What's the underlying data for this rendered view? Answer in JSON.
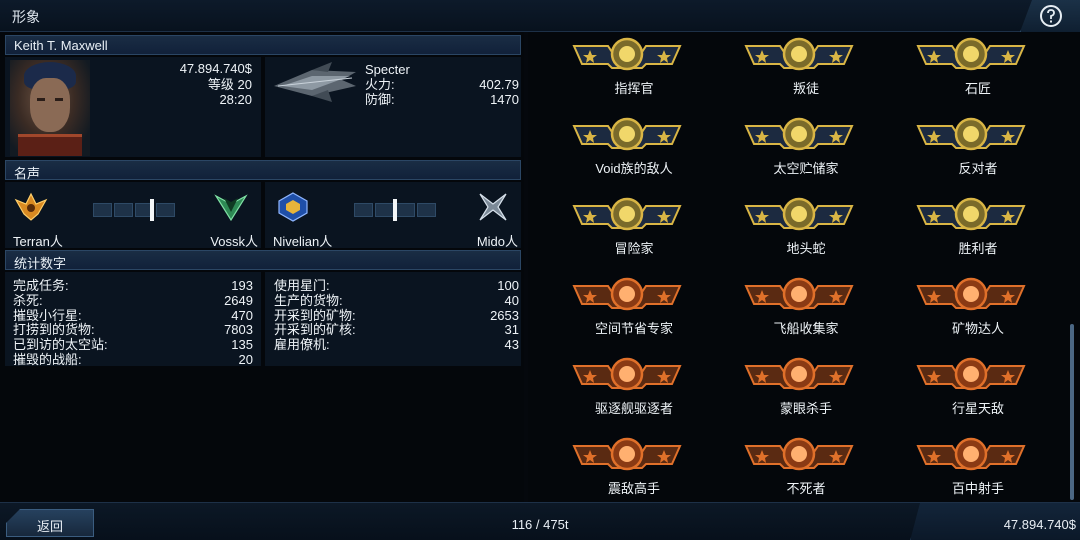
{
  "topbar": {
    "title": "形象"
  },
  "profile": {
    "header": "Keith T. Maxwell",
    "credits": "47.894.740$",
    "level": "等级 20",
    "playtime": "28:20",
    "ship_name": "Specter",
    "firepower_label": "火力:",
    "firepower_value": "402.79",
    "defense_label": "防御:",
    "defense_value": "1470"
  },
  "reputation": {
    "header": "名声",
    "pairs": [
      {
        "left": "Terran人",
        "right": "Vossk人",
        "marker_fraction": 0.72
      },
      {
        "left": "Nivelian人",
        "right": "Mido人",
        "marker_fraction": 0.5
      }
    ]
  },
  "stats": {
    "header": "统计数字",
    "left": [
      {
        "label": "完成任务:",
        "value": "193"
      },
      {
        "label": "杀死:",
        "value": "2649"
      },
      {
        "label": "摧毁小行星:",
        "value": "470"
      },
      {
        "label": "打捞到的货物:",
        "value": "7803"
      },
      {
        "label": "已到访的太空站:",
        "value": "135"
      },
      {
        "label": "摧毁的战船:",
        "value": "20"
      }
    ],
    "right": [
      {
        "label": "使用星门:",
        "value": "100"
      },
      {
        "label": "生产的货物:",
        "value": "40"
      },
      {
        "label": "开采到的矿物:",
        "value": "2653"
      },
      {
        "label": "开采到的矿核:",
        "value": "31"
      },
      {
        "label": "雇用僚机:",
        "value": "43"
      }
    ]
  },
  "achievements": [
    {
      "label": "指挥官",
      "tier": "gold",
      "icon": "commander-icon"
    },
    {
      "label": "叛徒",
      "tier": "gold",
      "icon": "traitor-icon"
    },
    {
      "label": "石匠",
      "tier": "gold",
      "icon": "mason-icon"
    },
    {
      "label": "Void族的敌人",
      "tier": "gold",
      "icon": "peace-hand-icon"
    },
    {
      "label": "太空贮储家",
      "tier": "gold",
      "icon": "cube-icon"
    },
    {
      "label": "反对者",
      "tier": "gold",
      "icon": "cross-icon"
    },
    {
      "label": "冒险家",
      "tier": "gold",
      "icon": "fist-icon"
    },
    {
      "label": "地头蛇",
      "tier": "gold",
      "icon": "starburst-icon"
    },
    {
      "label": "胜利者",
      "tier": "gold",
      "icon": "trophy-icon"
    },
    {
      "label": "空间节省专家",
      "tier": "bronze",
      "icon": "crate-icon"
    },
    {
      "label": "飞船收集家",
      "tier": "bronze",
      "icon": "p-icon"
    },
    {
      "label": "矿物达人",
      "tier": "bronze",
      "icon": "mineral-icon"
    },
    {
      "label": "驱逐舰驱逐者",
      "tier": "bronze",
      "icon": "flame-icon"
    },
    {
      "label": "蒙眼杀手",
      "tier": "bronze",
      "icon": "claw-icon"
    },
    {
      "label": "行星天敌",
      "tier": "bronze",
      "icon": "planet-icon"
    },
    {
      "label": "震敌高手",
      "tier": "bronze",
      "icon": "shock-icon"
    },
    {
      "label": "不死者",
      "tier": "bronze",
      "icon": "undead-icon"
    },
    {
      "label": "百中射手",
      "tier": "bronze",
      "icon": "target-icon"
    }
  ],
  "bottombar": {
    "back_label": "返回",
    "cargo": "116 / 475t",
    "credits": "47.894.740$"
  },
  "colors": {
    "gold": "#d9b545",
    "bronze": "#e0702a",
    "panel": "#0a1420",
    "header": "#1a2d44"
  }
}
